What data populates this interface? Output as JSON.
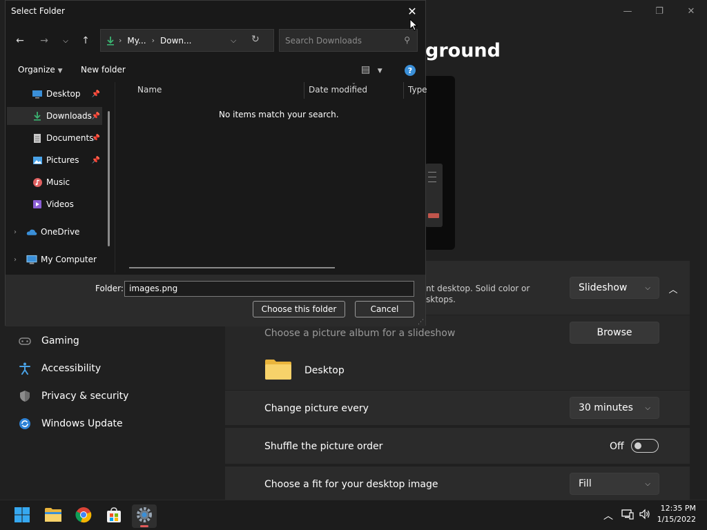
{
  "settings": {
    "page_title": "ground",
    "window_controls": {
      "minimize": "—",
      "maximize": "❐",
      "close": "✕"
    },
    "nav": [
      {
        "label": "Gaming",
        "icon": "gamepad-icon"
      },
      {
        "label": "Accessibility",
        "icon": "accessibility-icon"
      },
      {
        "label": "Privacy & security",
        "icon": "shield-icon"
      },
      {
        "label": "Windows Update",
        "icon": "update-icon"
      }
    ],
    "background": {
      "desc_line1": "nt desktop. Solid color or",
      "desc_line2": "sktops.",
      "type_value": "Slideshow",
      "album_label": "Choose a picture album for a slideshow",
      "browse_label": "Browse",
      "album_folder": "Desktop",
      "change_label": "Change picture every",
      "change_value": "30 minutes",
      "shuffle_label": "Shuffle the picture order",
      "shuffle_state": "Off",
      "fit_label": "Choose a fit for your desktop image",
      "fit_value": "Fill"
    }
  },
  "dialog": {
    "title": "Select Folder",
    "address": {
      "seg1": "My...",
      "seg2": "Down..."
    },
    "search_placeholder": "Search Downloads",
    "toolbar": {
      "organize": "Organize",
      "new_folder": "New folder",
      "help": "?"
    },
    "tree": [
      {
        "label": "Desktop",
        "pinned": true
      },
      {
        "label": "Downloads",
        "pinned": true,
        "selected": true
      },
      {
        "label": "Documents",
        "pinned": true
      },
      {
        "label": "Pictures",
        "pinned": true
      },
      {
        "label": "Music",
        "pinned": false
      },
      {
        "label": "Videos",
        "pinned": false
      },
      {
        "label": "OneDrive",
        "pinned": false
      },
      {
        "label": "My Computer",
        "pinned": false
      }
    ],
    "columns": {
      "name": "Name",
      "date": "Date modified",
      "type": "Type"
    },
    "empty_message": "No items match your search.",
    "folder_label": "Folder:",
    "folder_value": "images.png",
    "choose_button": "Choose this folder",
    "cancel_button": "Cancel"
  },
  "taskbar": {
    "apps": [
      "start-icon",
      "file-explorer-icon",
      "chrome-icon",
      "store-icon",
      "settings-icon"
    ],
    "time": "12:35 PM",
    "date": "1/15/2022"
  },
  "colors": {
    "accent_blue": "#3a8fd8",
    "folder_yellow": "#f2c94c",
    "download_green": "#3bb371"
  }
}
